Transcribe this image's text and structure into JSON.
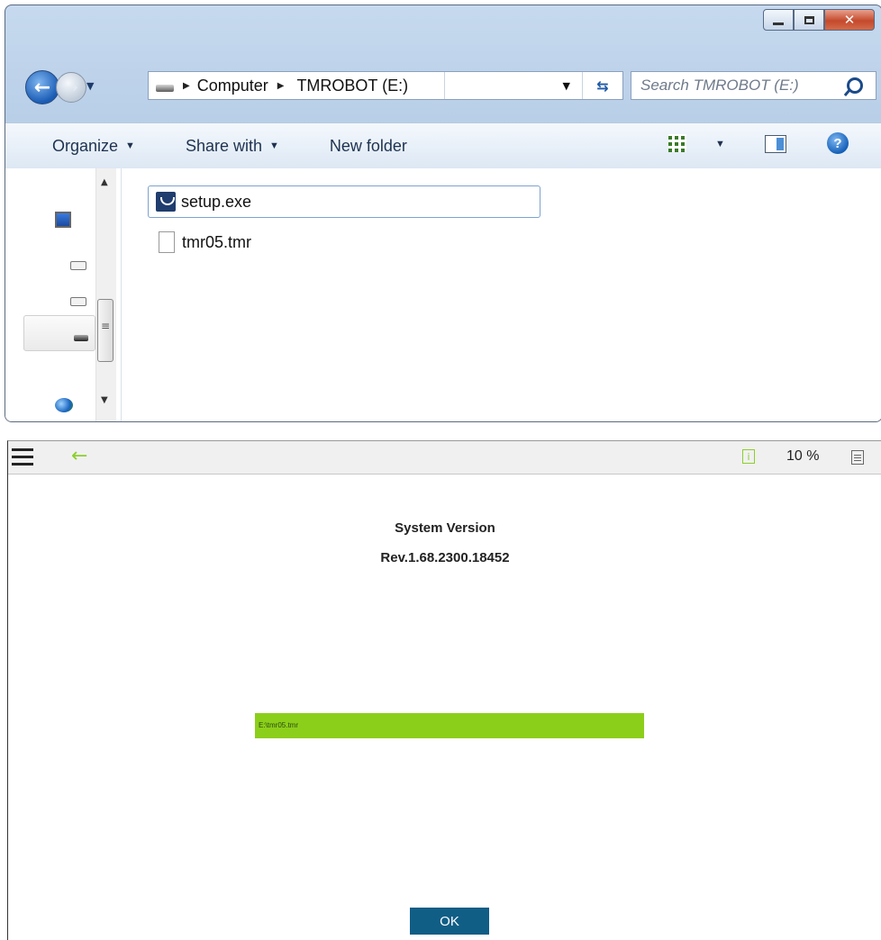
{
  "explorer": {
    "address": {
      "crumbs": [
        "Computer",
        "TMROBOT (E:)"
      ]
    },
    "search": {
      "placeholder": "Search TMROBOT (E:)"
    },
    "toolbar": {
      "organize": "Organize",
      "share_with": "Share with",
      "new_folder": "New folder"
    },
    "files": [
      {
        "name": "setup.exe",
        "icon": "installer-icon",
        "selected": true
      },
      {
        "name": "tmr05.tmr",
        "icon": "document-icon",
        "selected": false
      }
    ]
  },
  "tmflow": {
    "header": {
      "percent": "10 %"
    },
    "system_version_title": "System Version",
    "system_version_value": "Rev.1.68.2300.18452",
    "progress": {
      "label": "E:\\tmr05.tmr",
      "fraction": 1.0
    },
    "ok_label": "OK",
    "colors": {
      "accent_green": "#8ccf1a",
      "button_blue": "#105e86"
    }
  }
}
